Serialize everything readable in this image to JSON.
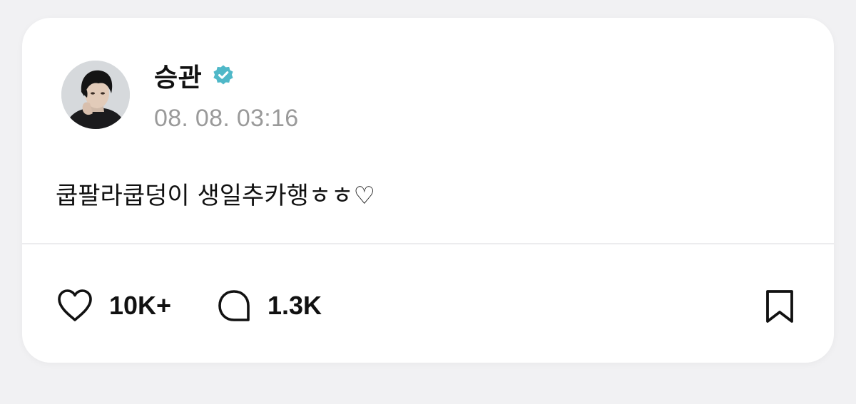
{
  "post": {
    "author": {
      "name": "승관",
      "verified": true,
      "verified_icon": "verified-badge-icon",
      "avatar_icon": "profile-photo"
    },
    "timestamp": "08. 08. 03:16",
    "text": "쿱팔라쿱덩이 생일추카행ㅎㅎ♡"
  },
  "actions": {
    "like": {
      "icon": "heart-icon",
      "count": "10K+"
    },
    "comment": {
      "icon": "comment-bubble-icon",
      "count": "1.3K"
    },
    "bookmark": {
      "icon": "bookmark-icon"
    }
  },
  "colors": {
    "background": "#f1f1f3",
    "card": "#ffffff",
    "verified": "#4fb8c8",
    "text": "#111111",
    "muted": "#9a9a9a"
  }
}
